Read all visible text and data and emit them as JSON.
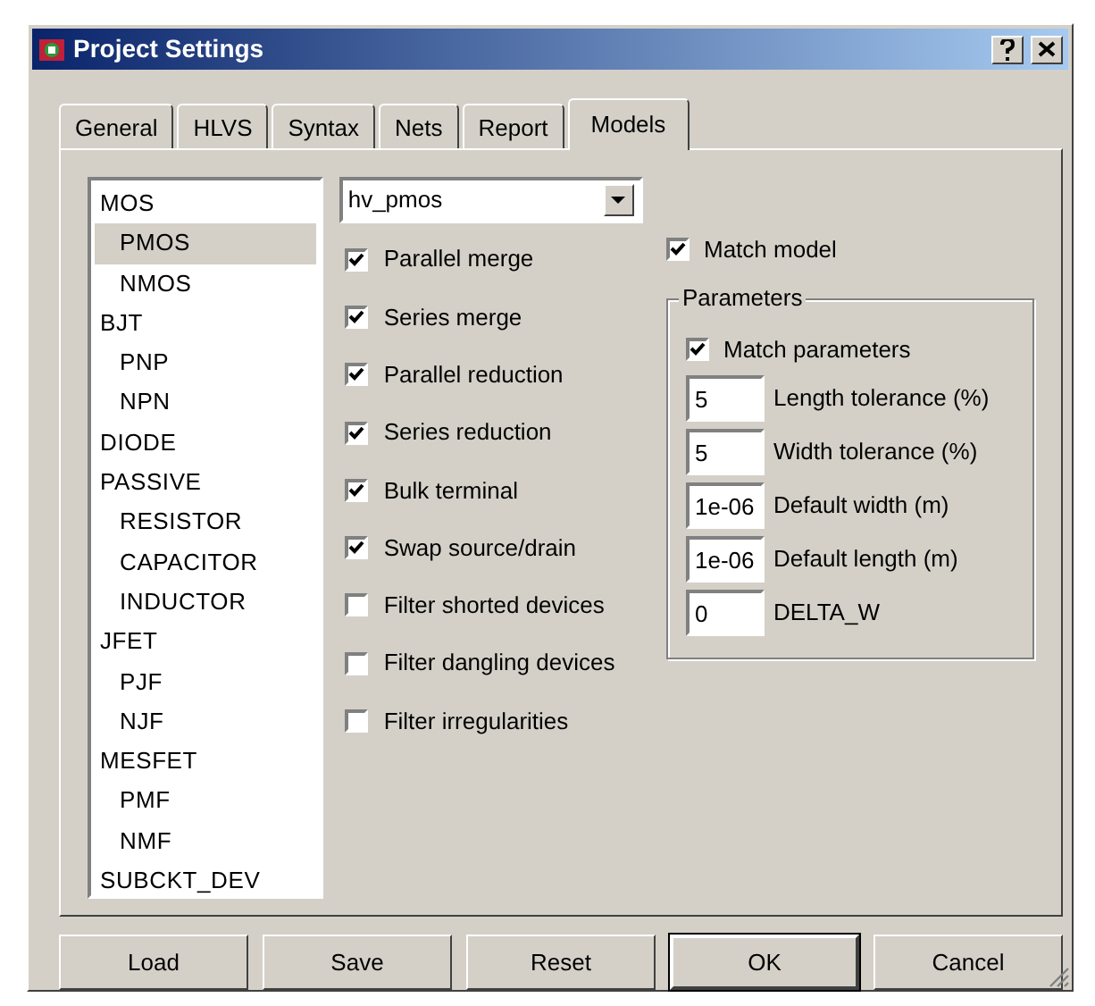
{
  "window": {
    "title": "Project Settings"
  },
  "tabs": [
    {
      "label": "General",
      "selected": false
    },
    {
      "label": "HLVS",
      "selected": false
    },
    {
      "label": "Syntax",
      "selected": false
    },
    {
      "label": "Nets",
      "selected": false
    },
    {
      "label": "Report",
      "selected": false
    },
    {
      "label": "Models",
      "selected": true
    }
  ],
  "model_tree": [
    {
      "label": "MOS",
      "selected": false,
      "children": [
        {
          "label": "PMOS",
          "selected": true
        },
        {
          "label": "NMOS",
          "selected": false
        }
      ]
    },
    {
      "label": "BJT",
      "selected": false,
      "children": [
        {
          "label": "PNP",
          "selected": false
        },
        {
          "label": "NPN",
          "selected": false
        }
      ]
    },
    {
      "label": "DIODE",
      "selected": false
    },
    {
      "label": "PASSIVE",
      "selected": false,
      "children": [
        {
          "label": "RESISTOR",
          "selected": false
        },
        {
          "label": "CAPACITOR",
          "selected": false
        },
        {
          "label": "INDUCTOR",
          "selected": false
        }
      ]
    },
    {
      "label": "JFET",
      "selected": false,
      "children": [
        {
          "label": "PJF",
          "selected": false
        },
        {
          "label": "NJF",
          "selected": false
        }
      ]
    },
    {
      "label": "MESFET",
      "selected": false,
      "children": [
        {
          "label": "PMF",
          "selected": false
        },
        {
          "label": "NMF",
          "selected": false
        }
      ]
    },
    {
      "label": "SUBCKT_DEV",
      "selected": false
    }
  ],
  "model_select": {
    "value": "hv_pmos"
  },
  "options": [
    {
      "label": "Parallel merge",
      "checked": true
    },
    {
      "label": "Series merge",
      "checked": true
    },
    {
      "label": "Parallel reduction",
      "checked": true
    },
    {
      "label": "Series reduction",
      "checked": true
    },
    {
      "label": "Bulk terminal",
      "checked": true
    },
    {
      "label": "Swap source/drain",
      "checked": true
    },
    {
      "label": "Filter shorted devices",
      "checked": false
    },
    {
      "label": "Filter dangling devices",
      "checked": false
    },
    {
      "label": "Filter irregularities",
      "checked": false
    }
  ],
  "match_model": {
    "label": "Match model",
    "checked": true
  },
  "parameters": {
    "title": "Parameters",
    "match_parameters": {
      "label": "Match parameters",
      "checked": true
    },
    "fields": [
      {
        "value": "5",
        "label": "Length tolerance (%)"
      },
      {
        "value": "5",
        "label": "Width tolerance (%)"
      },
      {
        "value": "1e-06",
        "label": "Default width (m)"
      },
      {
        "value": "1e-06",
        "label": "Default length (m)"
      },
      {
        "value": "0",
        "label": "DELTA_W"
      }
    ]
  },
  "buttons": [
    {
      "label": "Load",
      "default": false
    },
    {
      "label": "Save",
      "default": false
    },
    {
      "label": "Reset",
      "default": false
    },
    {
      "label": "OK",
      "default": true
    },
    {
      "label": "Cancel",
      "default": false
    }
  ]
}
